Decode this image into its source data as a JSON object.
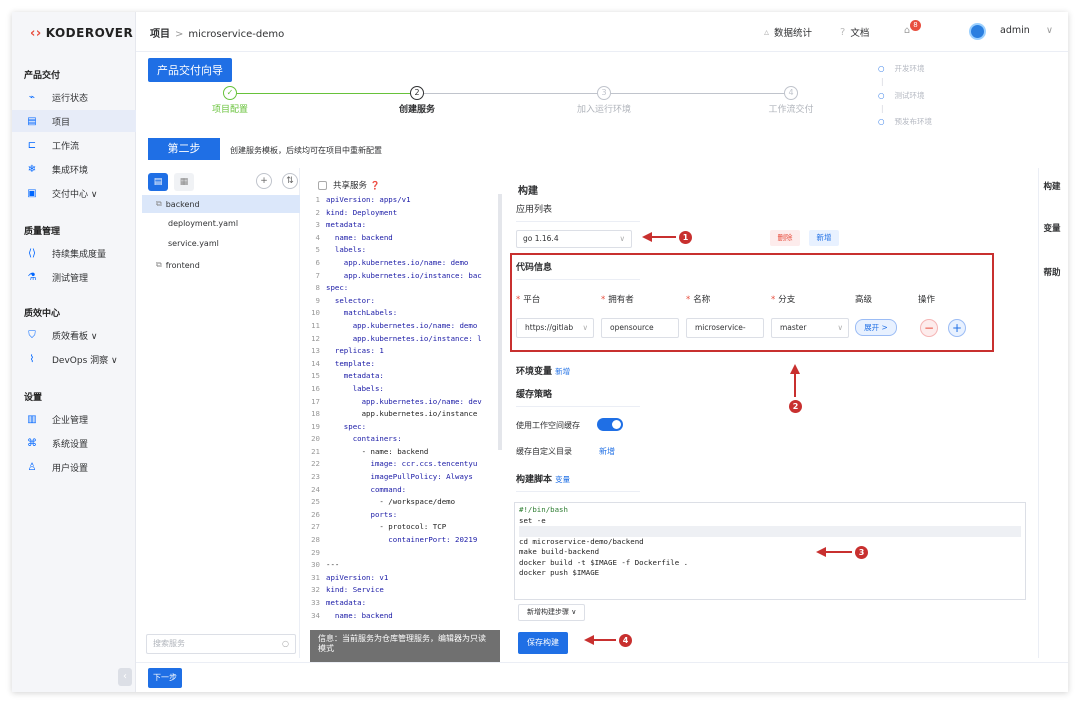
{
  "brand": {
    "logo_text": "KODEROVER"
  },
  "sidebar": {
    "sections": [
      {
        "title": "产品交付"
      },
      {
        "title": "质量管理"
      },
      {
        "title": "质效中心"
      },
      {
        "title": "设置"
      }
    ],
    "items": [
      {
        "label": "运行状态",
        "icon": "monitor-icon"
      },
      {
        "label": "项目",
        "icon": "project-icon",
        "active": true
      },
      {
        "label": "工作流",
        "icon": "workflow-icon"
      },
      {
        "label": "集成环境",
        "icon": "environment-icon"
      },
      {
        "label": "交付中心 ∨",
        "icon": "delivery-icon"
      },
      {
        "label": "持续集成度量",
        "icon": "ci-metrics-icon"
      },
      {
        "label": "测试管理",
        "icon": "test-icon"
      },
      {
        "label": "质效看板 ∨",
        "icon": "dashboard-icon"
      },
      {
        "label": "DevOps 洞察 ∨",
        "icon": "insight-icon"
      },
      {
        "label": "企业管理",
        "icon": "enterprise-icon"
      },
      {
        "label": "系统设置",
        "icon": "system-settings-icon"
      },
      {
        "label": "用户设置",
        "icon": "user-settings-icon"
      }
    ],
    "collapse_label": "‹"
  },
  "topbar": {
    "breadcrumb_root": "项目",
    "breadcrumb_sep": ">",
    "breadcrumb_current": "microservice-demo",
    "stats": "数据统计",
    "docs": "文档",
    "notify_count": "8",
    "user": "admin"
  },
  "wizard": {
    "title": "产品交付向导",
    "steps": [
      {
        "label": "项目配置",
        "marker": "✓"
      },
      {
        "label": "创建服务",
        "marker": "2"
      },
      {
        "label": "加入运行环境",
        "marker": "3"
      },
      {
        "label": "工作流交付",
        "marker": "4"
      }
    ],
    "envs": [
      "开发环境",
      "测试环境",
      "预发布环境"
    ],
    "step_button": "第二步",
    "step_desc": "创建服务模板，后续均可在项目中重新配置"
  },
  "services": {
    "items": [
      {
        "label": "backend",
        "indent": 0,
        "selected": true
      },
      {
        "label": "deployment.yaml",
        "indent": 1
      },
      {
        "label": "service.yaml",
        "indent": 1
      },
      {
        "label": "frontend",
        "indent": 0
      }
    ],
    "search_placeholder": "搜索服务"
  },
  "editor": {
    "share_label": "共享服务",
    "lines": [
      "apiVersion: apps/v1",
      "kind: Deployment",
      "metadata:",
      "  name: backend",
      "  labels:",
      "    app.kubernetes.io/name: demo",
      "    app.kubernetes.io/instance: bac",
      "spec:",
      "  selector:",
      "    matchLabels:",
      "      app.kubernetes.io/name: demo",
      "      app.kubernetes.io/instance: l",
      "  replicas: 1",
      "  template:",
      "    metadata:",
      "      labels:",
      "        app.kubernetes.io/name: dev",
      "        app.kubernetes.io/instance",
      "    spec:",
      "      containers:",
      "        - name: backend",
      "          image: ccr.ccs.tencentyu",
      "          imagePullPolicy: Always",
      "          command:",
      "            - /workspace/demo",
      "          ports:",
      "            - protocol: TCP",
      "              containerPort: 20219",
      "",
      "---",
      "apiVersion: v1",
      "kind: Service",
      "metadata:",
      "  name: backend"
    ],
    "readonly_note": "信息：当前服务为仓库管理服务，编辑器为只读模式"
  },
  "build": {
    "title": "构建",
    "app_list_label": "应用列表",
    "app_version": "go 1.16.4",
    "delete_label": "删除",
    "add_label": "新增",
    "code_info_label": "代码信息",
    "cols": {
      "platform": "平台",
      "owner": "拥有者",
      "name": "名称",
      "branch": "分支",
      "advanced": "高级",
      "ops": "操作"
    },
    "row": {
      "platform": "https://gitlab",
      "owner": "opensource",
      "name": "microservice-",
      "branch": "master",
      "expand": "展开 >"
    },
    "env_label": "环境变量",
    "env_add": "新增",
    "cache_label": "缓存策略",
    "use_cache_label": "使用工作空间缓存",
    "custom_dir_label": "缓存自定义目录",
    "custom_dir_add": "新增",
    "script_label": "构建脚本",
    "script_var": "变量",
    "script_lines": [
      "#!/bin/bash",
      "set -e",
      "",
      "cd microservice-demo/backend",
      "make build-backend",
      "docker build -t $IMAGE -f Dockerfile .",
      "docker push $IMAGE"
    ],
    "add_step": "新增构建步骤 ∨",
    "save": "保存构建"
  },
  "rail": {
    "tabs": [
      "构建",
      "变量",
      "帮助"
    ]
  },
  "footer": {
    "next": "下一步"
  },
  "annotations": [
    "1",
    "2",
    "3",
    "4"
  ],
  "colors": {
    "primary": "#1f6fe5",
    "annotation": "#c8302f",
    "sidebar_bg": "#f5f6f9"
  }
}
